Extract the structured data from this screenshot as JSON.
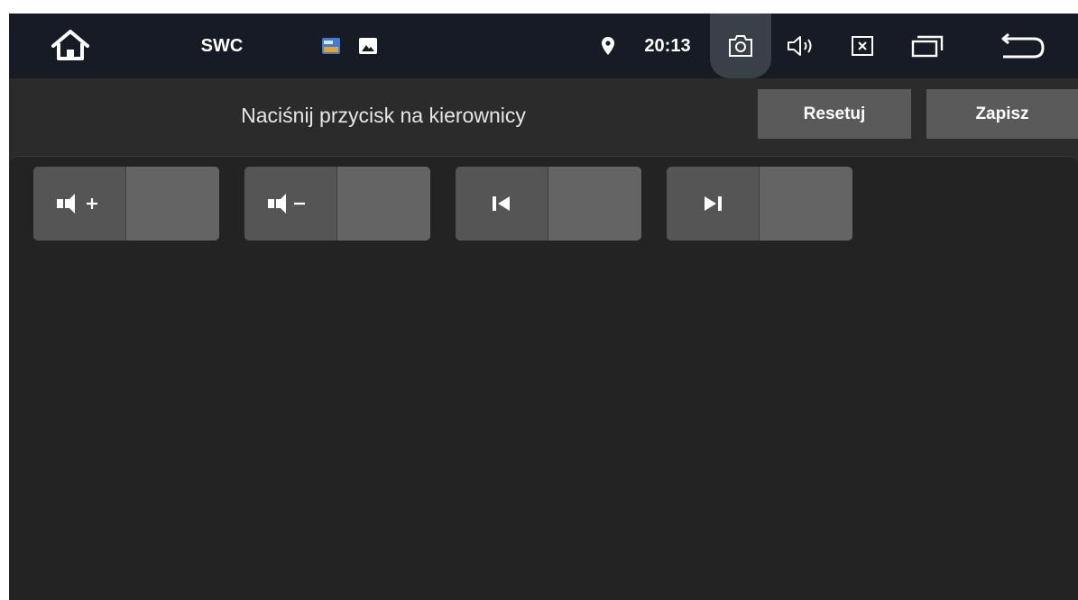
{
  "statusbar": {
    "home_icon": "home-icon",
    "title": "SWC",
    "app_icons": [
      "app-thumbnail-icon",
      "image-icon"
    ],
    "location_icon": "location-pin-icon",
    "time": "20:13",
    "actions": [
      "screenshot-icon",
      "volume-icon",
      "close-window-icon",
      "recent-apps-icon",
      "back-icon"
    ]
  },
  "header": {
    "prompt": "Naciśnij przycisk na kierownicy",
    "reset_label": "Resetuj",
    "save_label": "Zapisz"
  },
  "keys": [
    {
      "icon": "volume-up-icon",
      "assigned": ""
    },
    {
      "icon": "volume-down-icon",
      "assigned": ""
    },
    {
      "icon": "previous-track-icon",
      "assigned": ""
    },
    {
      "icon": "next-track-icon",
      "assigned": ""
    }
  ],
  "colors": {
    "statusbar_bg": "#171b26",
    "page_bg": "#2b2b2b",
    "panel_bg": "#232323",
    "button_bg": "#5a5a5a",
    "key_icon_bg": "#555555",
    "key_slot_bg": "#646464"
  }
}
